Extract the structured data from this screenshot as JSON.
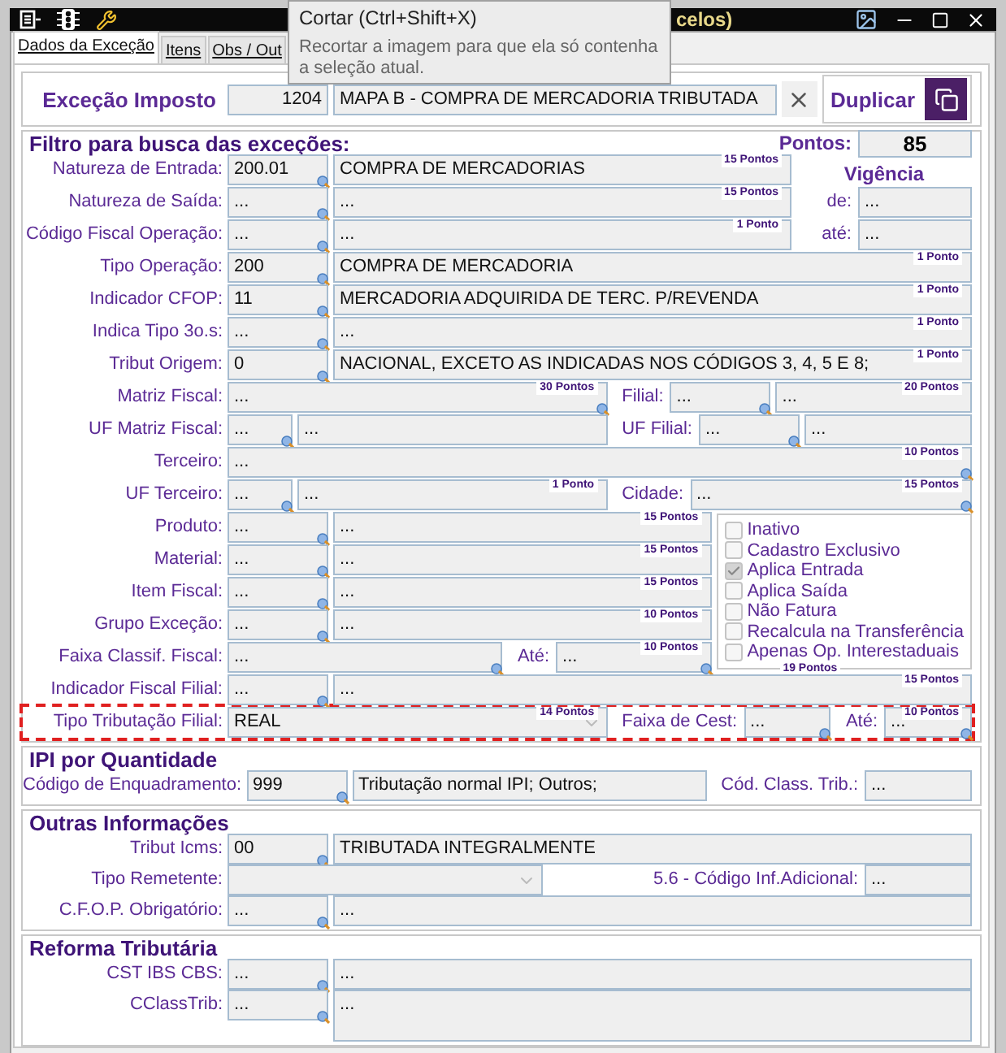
{
  "window": {
    "title": "celos)",
    "tooltip": {
      "title": "Cortar (Ctrl+Shift+X)",
      "text": "Recortar a imagem para que ela só contenha a seleção atual."
    }
  },
  "tabs": [
    {
      "label": "Dados da Exceção",
      "selected": true
    },
    {
      "label": "Itens",
      "selected": false
    },
    {
      "label": "Obs / Out",
      "selected": false
    }
  ],
  "header": {
    "label": "Exceção Imposto",
    "code": "1204",
    "description": "MAPA B - COMPRA DE MERCADORIA TRIBUTADA",
    "duplicate": "Duplicar"
  },
  "sections": [
    {
      "title": "Filtro para busca das exceções:",
      "score": {
        "label": "Pontos:",
        "value": "85"
      },
      "groups": [
        {
          "side": {
            "kind": "vigencia",
            "title": "Vigência",
            "fields": [
              {
                "label": "de:",
                "value": "..."
              },
              {
                "label": "até:",
                "value": "..."
              }
            ]
          },
          "rows": [
            {
              "label": "Natureza de Entrada:",
              "selected": false,
              "items": [
                {
                  "kind": "code",
                  "value": "200.01"
                },
                {
                  "kind": "desc",
                  "value": "COMPRA DE MERCADORIAS",
                  "points": "15 Pontos"
                }
              ]
            },
            {
              "label": "Natureza de Saída:",
              "selected": false,
              "items": [
                {
                  "kind": "code",
                  "value": "..."
                },
                {
                  "kind": "desc",
                  "value": "...",
                  "points": "15 Pontos"
                }
              ]
            },
            {
              "label": "Código Fiscal Operação:",
              "selected": false,
              "items": [
                {
                  "kind": "code",
                  "value": "..."
                },
                {
                  "kind": "desc",
                  "value": "...",
                  "points": "1 Ponto"
                }
              ]
            }
          ]
        },
        {
          "rows": [
            {
              "label": "Tipo Operação:",
              "selected": false,
              "items": [
                {
                  "kind": "code",
                  "value": "200"
                },
                {
                  "kind": "desc",
                  "value": "COMPRA DE MERCADORIA",
                  "points": "1 Ponto"
                }
              ]
            },
            {
              "label": "Indicador CFOP:",
              "selected": false,
              "items": [
                {
                  "kind": "code",
                  "value": "11"
                },
                {
                  "kind": "desc",
                  "value": "MERCADORIA ADQUIRIDA DE TERC. P/REVENDA",
                  "points": "1 Ponto"
                }
              ]
            },
            {
              "label": "Indica Tipo 3o.s:",
              "selected": false,
              "items": [
                {
                  "kind": "code",
                  "value": "..."
                },
                {
                  "kind": "desc",
                  "value": "...",
                  "points": "1 Ponto"
                }
              ]
            },
            {
              "label": "Tribut Origem:",
              "selected": false,
              "items": [
                {
                  "kind": "code",
                  "value": "0"
                },
                {
                  "kind": "desc",
                  "value": "NACIONAL, EXCETO AS INDICADAS NOS CÓDIGOS 3, 4, 5 E 8;",
                  "points": "1 Ponto"
                }
              ]
            },
            {
              "label": "Matriz Fiscal:",
              "selected": false,
              "items": [
                {
                  "kind": "search",
                  "value": "...",
                  "points": "30 Pontos"
                }
              ],
              "right": [
                {
                  "kind": "label",
                  "text": "Filial:"
                },
                {
                  "kind": "code",
                  "value": "..."
                },
                {
                  "kind": "desc",
                  "value": "...",
                  "points": "20 Pontos"
                }
              ]
            },
            {
              "label": "UF Matriz Fiscal:",
              "selected": false,
              "items": [
                {
                  "kind": "uf",
                  "value": "..."
                },
                {
                  "kind": "desc",
                  "value": "..."
                }
              ],
              "right": [
                {
                  "kind": "label",
                  "text": "UF Filial:"
                },
                {
                  "kind": "code",
                  "value": "..."
                },
                {
                  "kind": "desc",
                  "value": "..."
                }
              ]
            },
            {
              "label": "Terceiro:",
              "selected": false,
              "items": [
                {
                  "kind": "search",
                  "value": "...",
                  "points": "10 Pontos"
                }
              ]
            },
            {
              "label": "UF Terceiro:",
              "selected": false,
              "items": [
                {
                  "kind": "uf",
                  "value": "..."
                },
                {
                  "kind": "desc",
                  "value": "...",
                  "points": "1 Ponto"
                }
              ],
              "right": [
                {
                  "kind": "label",
                  "text": "Cidade:"
                },
                {
                  "kind": "search",
                  "value": "...",
                  "points": "15 Pontos"
                }
              ]
            }
          ]
        },
        {
          "side": {
            "kind": "flags",
            "points": "19 Pontos",
            "items": [
              {
                "label": "Inativo",
                "checked": false
              },
              {
                "label": "Cadastro Exclusivo",
                "checked": false
              },
              {
                "label": "Aplica Entrada",
                "checked": true
              },
              {
                "label": "Aplica Saída",
                "checked": false
              },
              {
                "label": "Não Fatura",
                "checked": false
              },
              {
                "label": "Recalcula na Transferência",
                "checked": false
              },
              {
                "label": "Apenas Op. Interestaduais",
                "checked": false
              }
            ]
          },
          "rows": [
            {
              "label": "Produto:",
              "selected": false,
              "items": [
                {
                  "kind": "code",
                  "value": "..."
                },
                {
                  "kind": "desc",
                  "value": "...",
                  "points": "15 Pontos"
                }
              ]
            },
            {
              "label": "Material:",
              "selected": false,
              "items": [
                {
                  "kind": "code",
                  "value": "..."
                },
                {
                  "kind": "desc",
                  "value": "...",
                  "points": "15 Pontos"
                }
              ]
            },
            {
              "label": "Item Fiscal:",
              "selected": false,
              "items": [
                {
                  "kind": "code",
                  "value": "..."
                },
                {
                  "kind": "desc",
                  "value": "...",
                  "points": "15 Pontos"
                }
              ]
            },
            {
              "label": "Grupo Exceção:",
              "selected": false,
              "items": [
                {
                  "kind": "code",
                  "value": "..."
                },
                {
                  "kind": "desc",
                  "value": "...",
                  "points": "10 Pontos"
                }
              ]
            },
            {
              "label": "Faixa Classif. Fiscal:",
              "selected": false,
              "items": [
                {
                  "kind": "search",
                  "value": "..."
                }
              ],
              "right": [
                {
                  "kind": "label",
                  "text": "Até:"
                },
                {
                  "kind": "search",
                  "value": "...",
                  "points": "10 Pontos"
                }
              ]
            }
          ]
        },
        {
          "rows": [
            {
              "label": "Indicador Fiscal Filial:",
              "selected": false,
              "items": [
                {
                  "kind": "code",
                  "value": "..."
                },
                {
                  "kind": "desc",
                  "value": "...",
                  "points": "15 Pontos"
                }
              ]
            },
            {
              "label": "Tipo Tributação Filial:",
              "selected": true,
              "items": [
                {
                  "kind": "select",
                  "value": "REAL",
                  "points": "14 Pontos"
                }
              ],
              "right": [
                {
                  "kind": "label",
                  "text": "Faixa de Cest:"
                },
                {
                  "kind": "search",
                  "value": "..."
                },
                {
                  "kind": "label",
                  "text": "Até:"
                },
                {
                  "kind": "search",
                  "value": "...",
                  "points": "10 Pontos"
                }
              ]
            }
          ]
        }
      ]
    },
    {
      "title": "IPI por Quantidade",
      "groups": [
        {
          "rows": [
            {
              "label": "Código de Enquadramento:",
              "selected": false,
              "items": [
                {
                  "kind": "code",
                  "value": "999"
                },
                {
                  "kind": "desc",
                  "value": "Tributação normal IPI; Outros;"
                },
                {
                  "kind": "label",
                  "text": "Cód. Class. Trib.:"
                },
                {
                  "kind": "short",
                  "value": "..."
                }
              ]
            }
          ]
        }
      ]
    },
    {
      "title": "Outras Informações",
      "groups": [
        {
          "rows": [
            {
              "label": "Tribut Icms:",
              "selected": false,
              "items": [
                {
                  "kind": "code",
                  "value": "00"
                },
                {
                  "kind": "desc",
                  "value": "TRIBUTADA INTEGRALMENTE"
                }
              ]
            },
            {
              "label": "Tipo Remetente:",
              "selected": false,
              "items": [
                {
                  "kind": "select"
                },
                {
                  "kind": "label",
                  "text": "5.6 - Código Inf.Adicional:"
                },
                {
                  "kind": "short",
                  "value": "..."
                }
              ]
            },
            {
              "label": "C.F.O.P. Obrigatório:",
              "selected": false,
              "items": [
                {
                  "kind": "code",
                  "value": "..."
                },
                {
                  "kind": "desc",
                  "value": "..."
                }
              ]
            }
          ]
        }
      ]
    },
    {
      "title": "Reforma Tributária",
      "groups": [
        {
          "rows": [
            {
              "label": "CST IBS CBS:",
              "selected": false,
              "items": [
                {
                  "kind": "code",
                  "value": "..."
                },
                {
                  "kind": "desc",
                  "value": "..."
                }
              ]
            },
            {
              "label": "CClassTrib:",
              "selected": false,
              "items": [
                {
                  "kind": "code",
                  "value": "..."
                },
                {
                  "kind": "memo",
                  "value": "..."
                }
              ]
            }
          ]
        }
      ]
    }
  ]
}
